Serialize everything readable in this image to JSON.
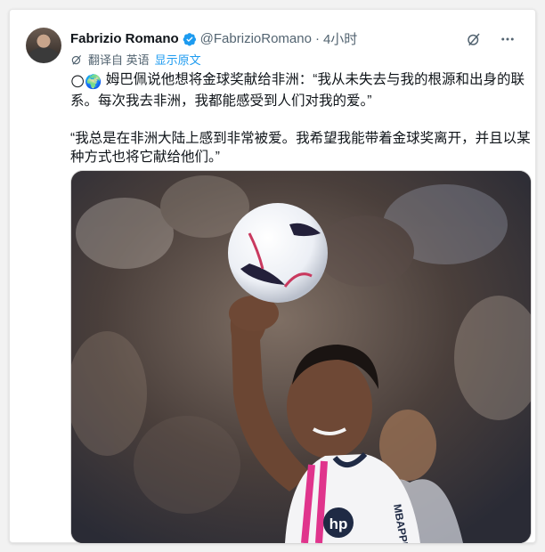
{
  "tweet": {
    "author_name": "Fabrizio Romano",
    "handle": "@FabrizioRomano",
    "separator": "·",
    "time": "4小时",
    "translation_label": "翻译自 英语",
    "show_original": "显示原文",
    "emoji_1": "🌕",
    "emoji_2": "🌍",
    "text_line_1": " 姆巴佩说他想将金球奖献给非洲：“我从未失去与我的根源和出身的联系。每次我去非洲，我都能感受到人们对我的爱。”",
    "text_para_2": "“我总是在非洲大陆上感到非常被爱。我希望我能带着金球奖离开，并且以某种方式也将它献给他们。”",
    "photo_jersey_text": "hp",
    "photo_jersey_name": "MBAPPÉ"
  },
  "icons": {
    "verified": "verified-badge-icon",
    "grok": "grok-icon",
    "more": "more-icon",
    "translate": "translate-icon"
  },
  "colors": {
    "verified": "#1d9bf0",
    "link": "#1d9bf0",
    "muted": "#536471"
  }
}
